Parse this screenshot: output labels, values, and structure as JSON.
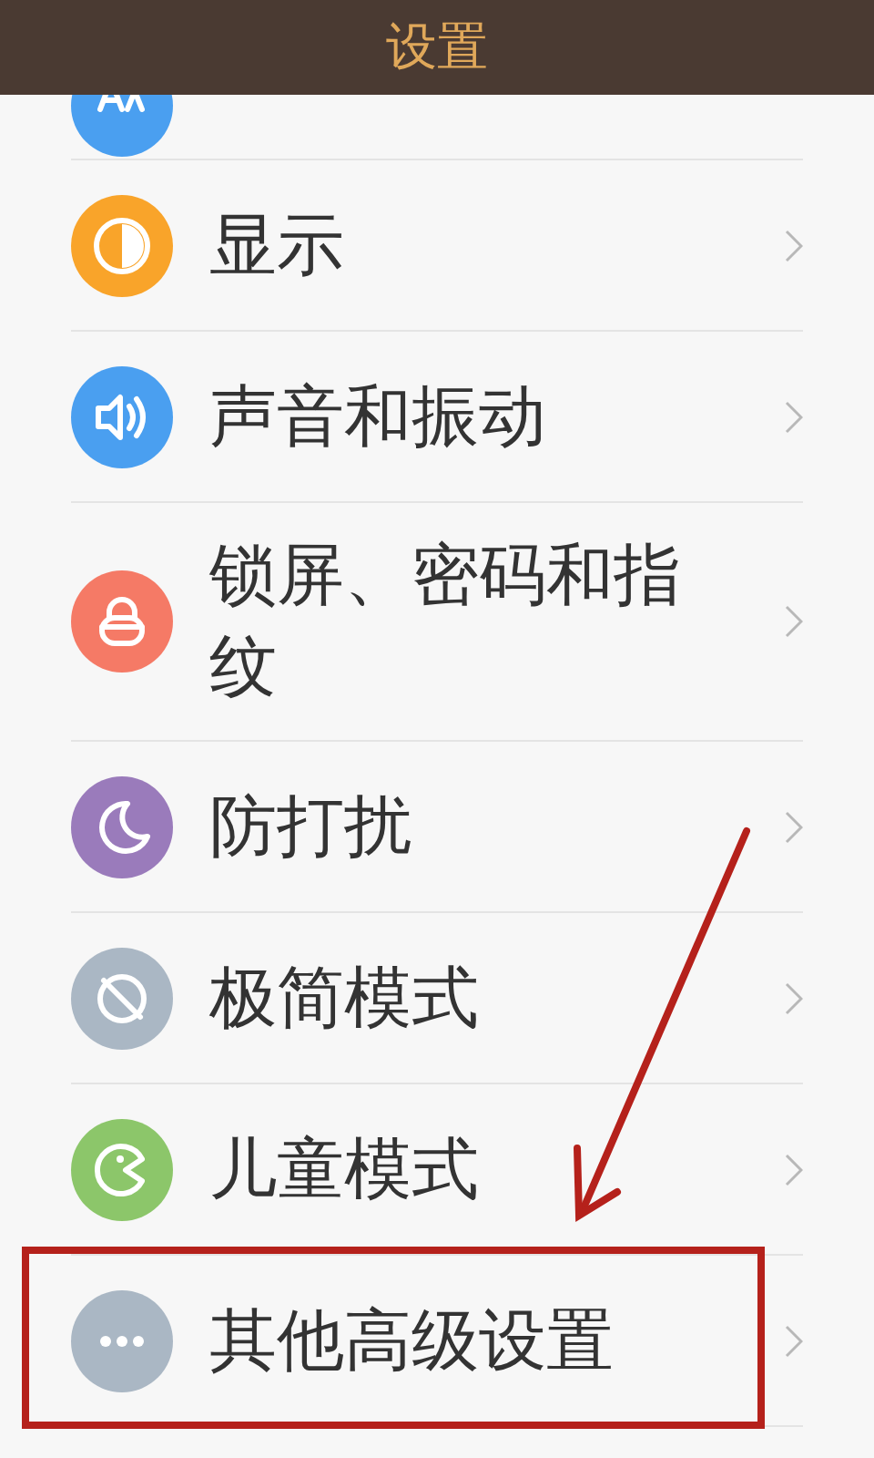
{
  "header": {
    "title": "设置"
  },
  "top_partial_item": {
    "kind": "font",
    "color": "#4a9ff0"
  },
  "items": [
    {
      "kind": "display",
      "color": "#f9a42a",
      "label": "显示"
    },
    {
      "kind": "sound",
      "color": "#4a9ff0",
      "label": "声音和振动"
    },
    {
      "kind": "lock",
      "color": "#f57a66",
      "label": "锁屏、密码和指纹"
    },
    {
      "kind": "moon",
      "color": "#9a7bbb",
      "label": "防打扰"
    },
    {
      "kind": "simple",
      "color": "#aab7c4",
      "label": "极简模式"
    },
    {
      "kind": "kids",
      "color": "#8cc66a",
      "label": "儿童模式"
    },
    {
      "kind": "more",
      "color": "#aab7c4",
      "label": "其他高级设置"
    }
  ],
  "annotation": {
    "kind": "box-and-arrow"
  }
}
